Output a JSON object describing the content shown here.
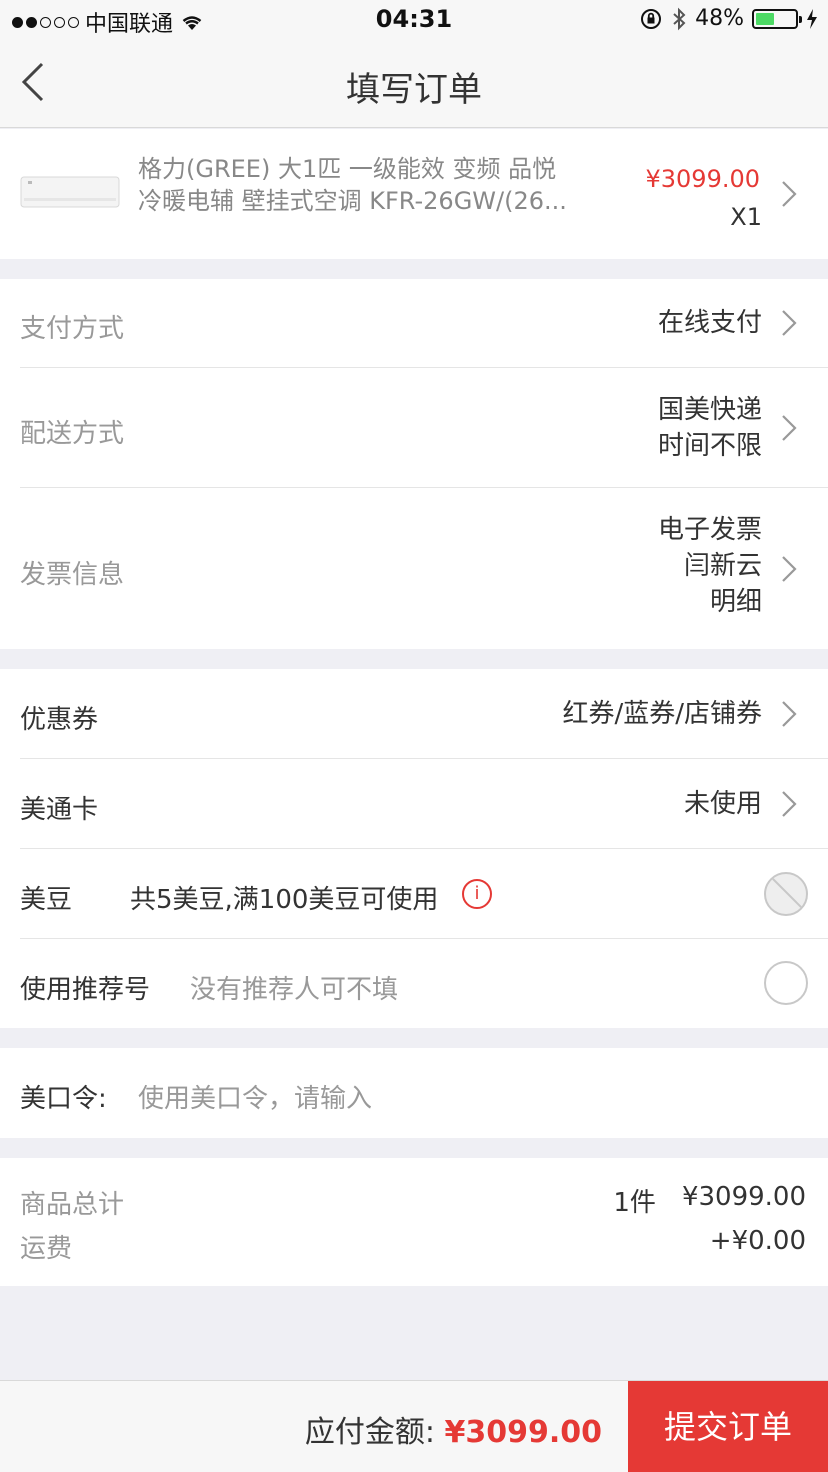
{
  "status_bar": {
    "carrier": "中国联通",
    "time": "04:31",
    "battery": "48%",
    "battery_level": 0.48
  },
  "header": {
    "title": "填写订单"
  },
  "product": {
    "name_line1": "格力(GREE) 大1匹 一级能效 变频 品悦",
    "name_line2": "冷暖电辅 壁挂式空调 KFR-26GW/(26...",
    "price": "¥3099.00",
    "quantity": "X1"
  },
  "payment": {
    "label": "支付方式",
    "value": "在线支付"
  },
  "delivery": {
    "label": "配送方式",
    "value_line1": "国美快递",
    "value_line2": "时间不限"
  },
  "invoice": {
    "label": "发票信息",
    "value_line1": "电子发票",
    "value_line2": "闫新云",
    "value_line3": "明细"
  },
  "coupon": {
    "label": "优惠券",
    "value": "红券/蓝券/店铺券"
  },
  "meitong_card": {
    "label": "美通卡",
    "value": "未使用"
  },
  "meidou": {
    "label": "美豆",
    "desc": "共5美豆,满100美豆可使用",
    "info_icon": "i"
  },
  "referral": {
    "label": "使用推荐号",
    "placeholder": "没有推荐人可不填"
  },
  "meikouling": {
    "label": "美口令:",
    "placeholder": "使用美口令，请输入"
  },
  "summary": {
    "goods_label": "商品总计",
    "goods_count": "1件",
    "goods_amount": "¥3099.00",
    "shipping_label": "运费",
    "shipping_amount": "+¥0.00"
  },
  "footer": {
    "payable_label": "应付金额:",
    "payable_amount": "¥3099.00",
    "submit_label": "提交订单"
  },
  "colors": {
    "accent": "#e53935",
    "background": "#efeff4",
    "battery_green": "#4cd964"
  }
}
